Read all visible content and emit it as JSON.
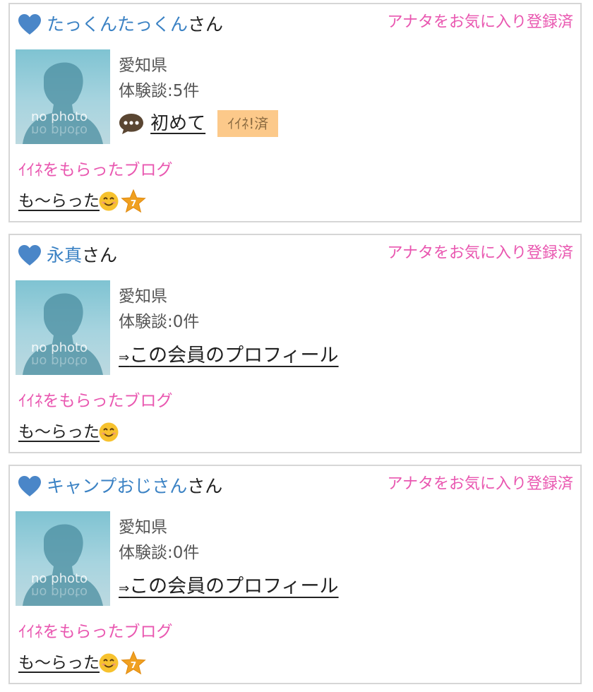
{
  "cards": [
    {
      "name": "たっくんたっくん",
      "honorific": "さん",
      "favorite_status": "アナタをお気に入り登録済",
      "photo_text": "no photo",
      "prefecture": "愛知県",
      "experience": "体験談:5件",
      "comment_label": "初めて",
      "like_badge": "ｲｲﾈ!済",
      "blog_heading": "ｲｲﾈをもらったブログ",
      "blog_title": "も〜らった",
      "star_number": "7"
    },
    {
      "name": "永真",
      "honorific": "さん",
      "favorite_status": "アナタをお気に入り登録済",
      "photo_text": "no photo",
      "prefecture": "愛知県",
      "experience": "体験談:0件",
      "profile_arrow": "⇒",
      "profile_link": "この会員のプロフィール",
      "blog_heading": "ｲｲﾈをもらったブログ",
      "blog_title": "も〜らった"
    },
    {
      "name": "キャンプおじさん",
      "honorific": "さん",
      "favorite_status": "アナタをお気に入り登録済",
      "photo_text": "no photo",
      "prefecture": "愛知県",
      "experience": "体験談:0件",
      "profile_arrow": "⇒",
      "profile_link": "この会員のプロフィール",
      "blog_heading": "ｲｲﾈをもらったブログ",
      "blog_title": "も〜らった",
      "star_number": "7"
    }
  ],
  "colors": {
    "name_link": "#3b82c4",
    "pink_accent": "#e957b0",
    "like_badge_bg": "#fcc98a",
    "heart": "#4a86c8",
    "star": "#f0a020"
  },
  "icons": {
    "favorite": "heart-icon",
    "comment": "speech-bubble-icon",
    "emoji": "smile-icon",
    "rank": "star-badge-icon"
  }
}
